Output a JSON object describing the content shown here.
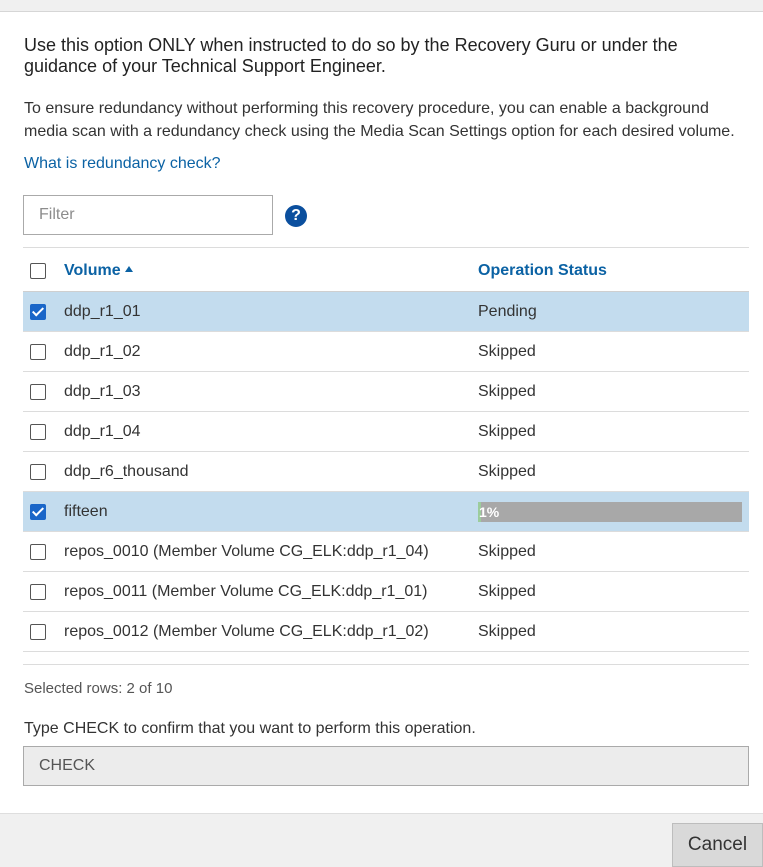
{
  "dialog": {
    "warning_text": "Use this option ONLY when instructed to do so by the Recovery Guru or under the guidance of your Technical Support Engineer.",
    "info_text": "To ensure redundancy without performing this recovery procedure, you can enable a background media scan with a redundancy check using the Media Scan Settings option for each desired volume.",
    "link_text": "What is redundancy check?",
    "filter": {
      "placeholder": "Filter",
      "value": ""
    },
    "help_icon": "question-circle-icon",
    "help_glyph": "?"
  },
  "table": {
    "columns": {
      "volume": "Volume",
      "status": "Operation Status"
    },
    "sort": {
      "column": "volume",
      "direction": "ascending"
    },
    "rows": [
      {
        "volume": "ddp_r1_01",
        "status": "Pending",
        "selected": true
      },
      {
        "volume": "ddp_r1_02",
        "status": "Skipped",
        "selected": false
      },
      {
        "volume": "ddp_r1_03",
        "status": "Skipped",
        "selected": false
      },
      {
        "volume": "ddp_r1_04",
        "status": "Skipped",
        "selected": false
      },
      {
        "volume": "ddp_r6_thousand",
        "status": "Skipped",
        "selected": false
      },
      {
        "volume": "fifteen",
        "status": "",
        "progress_label": "1%",
        "progress": 0.01,
        "selected": true
      },
      {
        "volume": "repos_0010 (Member Volume CG_ELK:ddp_r1_04)",
        "status": "Skipped",
        "selected": false
      },
      {
        "volume": "repos_0011 (Member Volume CG_ELK:ddp_r1_01)",
        "status": "Skipped",
        "selected": false
      },
      {
        "volume": "repos_0012 (Member Volume CG_ELK:ddp_r1_02)",
        "status": "Skipped",
        "selected": false
      }
    ]
  },
  "selected_rows_text": "Selected rows: 2 of 10",
  "confirm": {
    "label": "Type CHECK to confirm that you want to perform this operation.",
    "value": "CHECK"
  },
  "buttons": {
    "cancel": "Cancel"
  },
  "colors": {
    "link": "#0b62a4",
    "selected_row": "#c3dcee",
    "checkbox_checked": "#1a66c8",
    "progress_track": "#a8a8a8",
    "progress_fill": "#9ccc9c"
  }
}
